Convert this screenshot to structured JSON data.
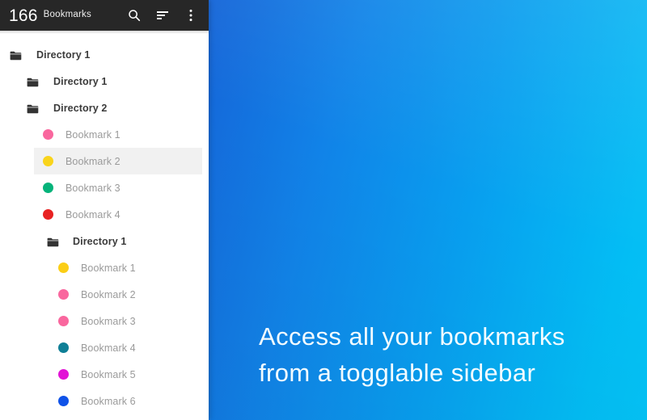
{
  "header": {
    "count": "166",
    "title": "Bookmarks",
    "actions": [
      {
        "name": "search-icon",
        "label": "Search"
      },
      {
        "name": "sort-icon",
        "label": "Sort"
      },
      {
        "name": "overflow-menu-icon",
        "label": "More options"
      }
    ]
  },
  "tree": [
    {
      "type": "directory",
      "label": "Directory 1",
      "level": 0,
      "highlight": false
    },
    {
      "type": "directory",
      "label": "Directory 1",
      "level": 1,
      "highlight": false
    },
    {
      "type": "directory",
      "label": "Directory 2",
      "level": 1,
      "highlight": false
    },
    {
      "type": "bookmark",
      "label": "Bookmark 1",
      "level": 2,
      "color": "#f9679e",
      "highlight": false
    },
    {
      "type": "bookmark",
      "label": "Bookmark 2",
      "level": 2,
      "color": "#f9d41b",
      "highlight": true
    },
    {
      "type": "bookmark",
      "label": "Bookmark 3",
      "level": 2,
      "color": "#05b37a",
      "highlight": false
    },
    {
      "type": "bookmark",
      "label": "Bookmark 4",
      "level": 2,
      "color": "#e82222",
      "highlight": false
    },
    {
      "type": "directory",
      "label": "Directory 1",
      "level": 2,
      "highlight": false
    },
    {
      "type": "bookmark",
      "label": "Bookmark 1",
      "level": 3,
      "color": "#fbce16",
      "highlight": false
    },
    {
      "type": "bookmark",
      "label": "Bookmark 2",
      "level": 3,
      "color": "#f9679e",
      "highlight": false
    },
    {
      "type": "bookmark",
      "label": "Bookmark 3",
      "level": 3,
      "color": "#f9679e",
      "highlight": false
    },
    {
      "type": "bookmark",
      "label": "Bookmark 4",
      "level": 3,
      "color": "#0f7f96",
      "highlight": false
    },
    {
      "type": "bookmark",
      "label": "Bookmark 5",
      "level": 3,
      "color": "#e213d6",
      "highlight": false
    },
    {
      "type": "bookmark",
      "label": "Bookmark 6",
      "level": 3,
      "color": "#0f52e8",
      "highlight": false
    }
  ],
  "hero": {
    "caption_line1": "Access all your bookmarks",
    "caption_line2": "from a togglable sidebar",
    "gradient_start": "#1565d8",
    "gradient_end": "#05c3f6"
  }
}
